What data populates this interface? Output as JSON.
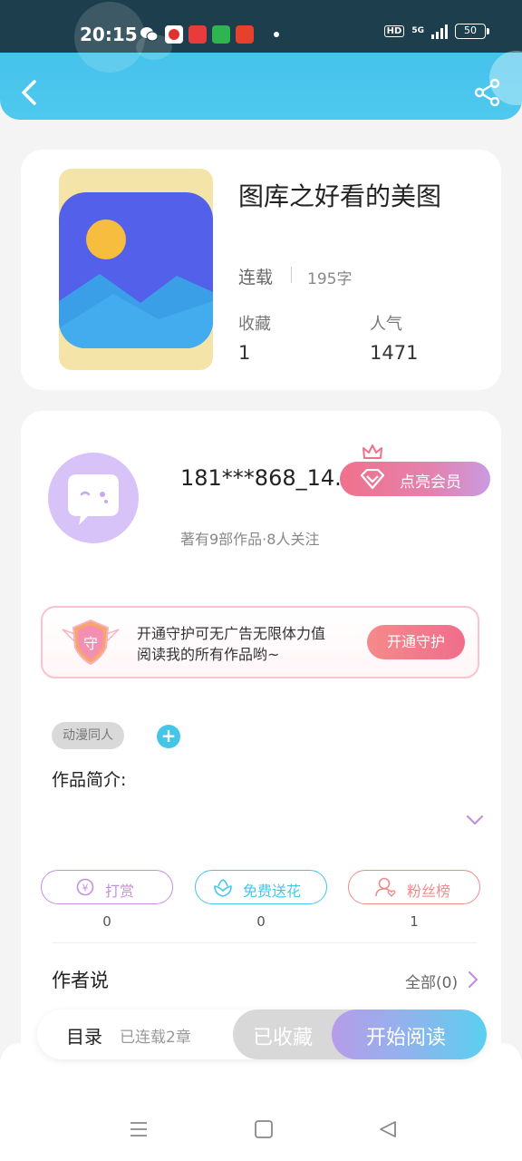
{
  "status_bar": {
    "time": "20:15",
    "hd": "HD",
    "network": "5G",
    "battery": "50"
  },
  "book": {
    "title": "图库之好看的美图",
    "status": "连载",
    "word_count": "195字",
    "favorites_label": "收藏",
    "favorites_value": "1",
    "popularity_label": "人气",
    "popularity_value": "1471"
  },
  "author": {
    "name": "181***868_14...",
    "meta": "著有9部作品·8人关注",
    "vip_label": "点亮会员"
  },
  "guard": {
    "line1": "开通守护可无广告无限体力值",
    "line2": "阅读我的所有作品哟~",
    "button": "开通守护",
    "badge_char": "守"
  },
  "tags": {
    "items": [
      "动漫同人"
    ],
    "add": "+"
  },
  "intro": {
    "label": "作品简介:"
  },
  "actions": [
    {
      "label": "打赏",
      "count": "0",
      "color": "#c58fe0"
    },
    {
      "label": "免费送花",
      "count": "0",
      "color": "#45c6e9"
    },
    {
      "label": "粉丝榜",
      "count": "1",
      "color": "#ec8c8c"
    }
  ],
  "author_says": {
    "title": "作者说",
    "all": "全部(0)"
  },
  "bottom_bar": {
    "toc": "目录",
    "toc_sub": "已连载2章",
    "collected": "已收藏",
    "read": "开始阅读"
  },
  "colors": {
    "accent_blue": "#46c3ec",
    "accent_pink": "#f06d8c",
    "accent_purple": "#c58fe0"
  }
}
